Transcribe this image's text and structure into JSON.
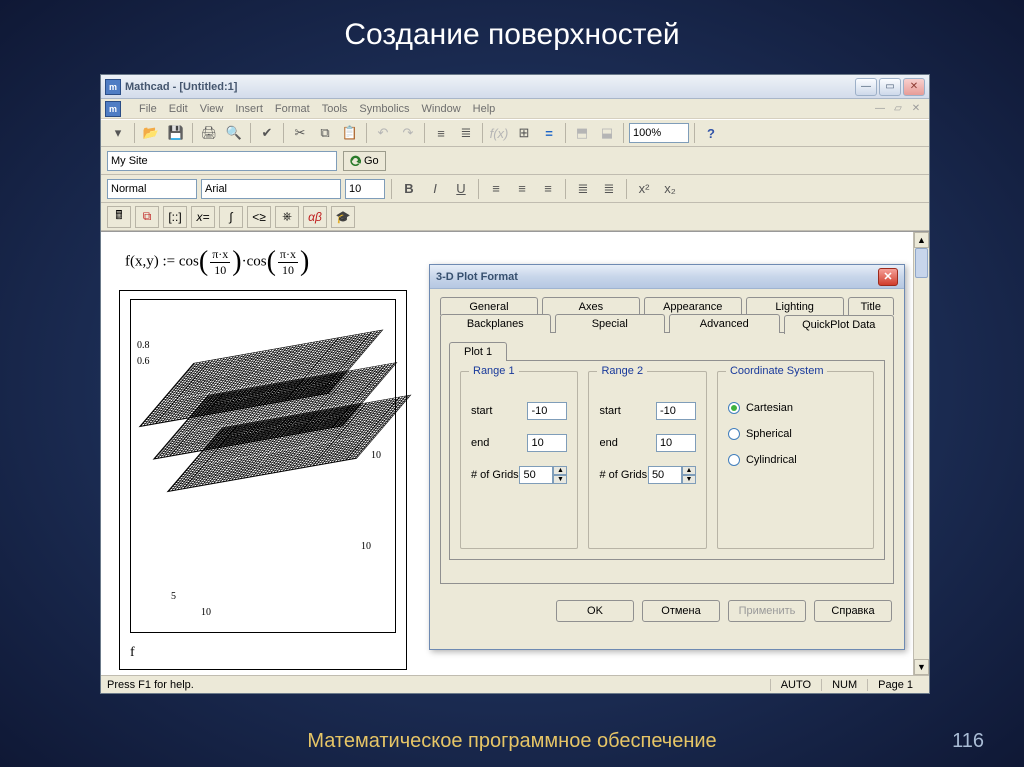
{
  "slide": {
    "title": "Создание поверхностей",
    "footer": "Математическое программное обеспечение",
    "page": "116"
  },
  "win": {
    "title": "Mathcad - [Untitled:1]",
    "menus": [
      "File",
      "Edit",
      "View",
      "Insert",
      "Format",
      "Tools",
      "Symbolics",
      "Window",
      "Help"
    ],
    "zoom": "100%",
    "site": "My Site",
    "go": "Go",
    "style": "Normal",
    "font": "Arial",
    "fontsize": "10",
    "status_help": "Press F1 for help.",
    "status_auto": "AUTO",
    "status_num": "NUM",
    "status_page": "Page 1"
  },
  "formula": {
    "lhs": "f(x,y) :=",
    "fn1": "cos",
    "fn2": "cos",
    "num1": "π·x",
    "den1": "10",
    "num2": "π·x",
    "den2": "10",
    "dot": "·"
  },
  "plot": {
    "label": "f",
    "ticks_y": [
      "0.8",
      "0.6"
    ],
    "ticks_x": [
      "5",
      "10",
      "10",
      "10"
    ]
  },
  "dialog": {
    "title": "3-D Plot Format",
    "tabs_row1": [
      "General",
      "Axes",
      "Appearance",
      "Lighting",
      "Title"
    ],
    "tabs_row2": [
      "Backplanes",
      "Special",
      "Advanced",
      "QuickPlot Data"
    ],
    "subtab": "Plot 1",
    "range1_title": "Range 1",
    "range2_title": "Range 2",
    "coord_title": "Coordinate System",
    "start_label": "start",
    "end_label": "end",
    "grids_label": "# of Grids",
    "r1_start": "-10",
    "r1_end": "10",
    "r1_grids": "50",
    "r2_start": "-10",
    "r2_end": "10",
    "r2_grids": "50",
    "coord_cartesian": "Cartesian",
    "coord_spherical": "Spherical",
    "coord_cylindrical": "Cylindrical",
    "btn_ok": "OK",
    "btn_cancel": "Отмена",
    "btn_apply": "Применить",
    "btn_help": "Справка"
  }
}
